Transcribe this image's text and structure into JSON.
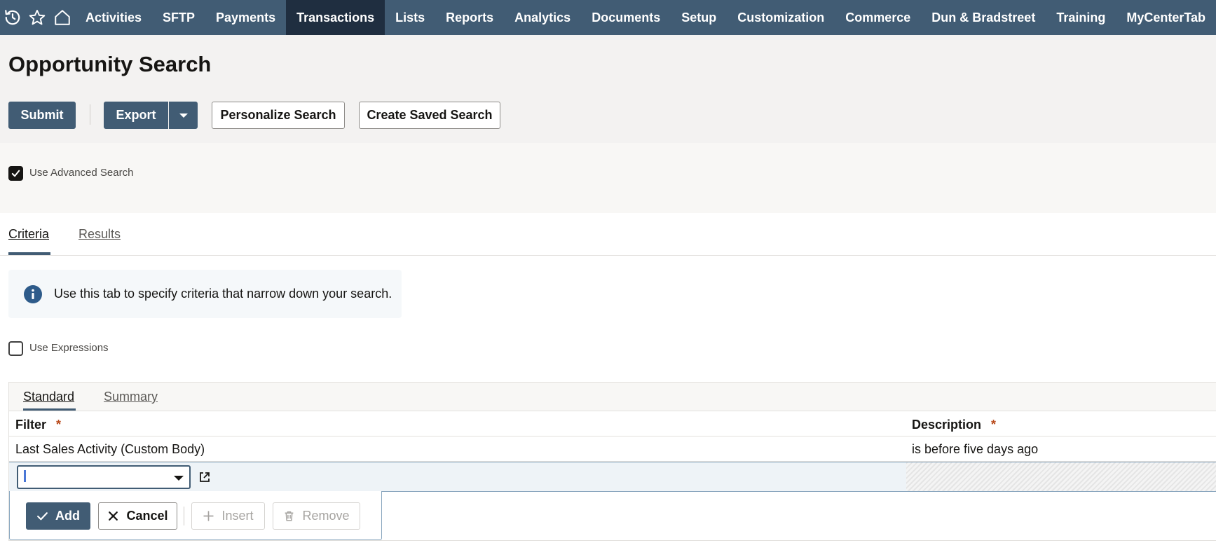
{
  "nav": {
    "icons": [
      "recent-history-icon",
      "favorites-star-icon",
      "home-icon"
    ],
    "items": [
      "Activities",
      "SFTP",
      "Payments",
      "Transactions",
      "Lists",
      "Reports",
      "Analytics",
      "Documents",
      "Setup",
      "Customization",
      "Commerce",
      "Dun & Bradstreet",
      "Training",
      "MyCenterTab"
    ],
    "active": "Transactions"
  },
  "page": {
    "title": "Opportunity Search"
  },
  "toolbar": {
    "submit": "Submit",
    "export": "Export",
    "personalize": "Personalize Search",
    "create_saved": "Create Saved Search"
  },
  "advanced": {
    "label": "Use Advanced Search",
    "checked": true
  },
  "tabs": {
    "criteria": "Criteria",
    "results": "Results",
    "active": "Criteria"
  },
  "info": {
    "text": "Use this tab to specify criteria that narrow down your search."
  },
  "expressions": {
    "label": "Use Expressions",
    "checked": false
  },
  "subtabs": {
    "standard": "Standard",
    "summary": "Summary",
    "active": "Standard"
  },
  "grid": {
    "columns": {
      "filter": "Filter",
      "description": "Description",
      "required_marker": "*"
    },
    "rows": [
      {
        "filter": "Last Sales Activity (Custom Body)",
        "description": "is before five days ago"
      }
    ],
    "edit_row": {
      "filter_value": ""
    }
  },
  "row_actions": {
    "add": "Add",
    "cancel": "Cancel",
    "insert": "Insert",
    "remove": "Remove"
  },
  "colors": {
    "nav_bg": "#415c74",
    "nav_active": "#1f2e40",
    "primary_button": "#415c74",
    "required_marker": "#b94a1b"
  }
}
